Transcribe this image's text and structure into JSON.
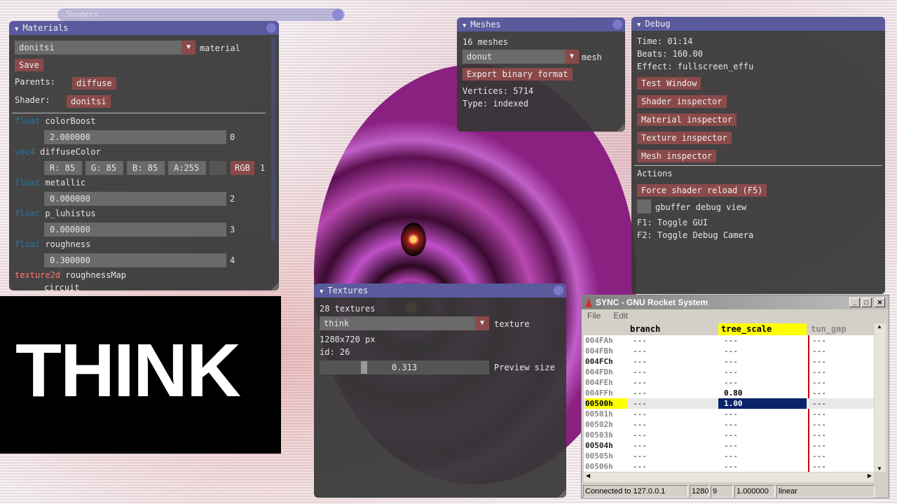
{
  "shaders_title": "Shaders",
  "materials": {
    "title": "Materials",
    "selected": "donitsi",
    "label": "material",
    "save": "Save",
    "parents_label": "Parents:",
    "parents_value": "diffuse",
    "shader_label": "Shader:",
    "shader_value": "donitsi",
    "params": [
      {
        "type": "float",
        "name": "colorBoost",
        "value": "2.000000",
        "index": "0"
      },
      {
        "type": "vec4",
        "name": "diffuseColor",
        "r": "R: 85",
        "g": "G: 85",
        "b": "B: 85",
        "a": "A:255",
        "mode": "RGB",
        "index": "1"
      },
      {
        "type": "float",
        "name": "metallic",
        "value": "0.000000",
        "index": "2"
      },
      {
        "type": "float",
        "name": "p_luhistus",
        "value": "0.000000",
        "index": "3"
      },
      {
        "type": "float",
        "name": "roughness",
        "value": "0.300000",
        "index": "4"
      },
      {
        "type": "texture2d",
        "name": "roughnessMap",
        "value": "circuit"
      }
    ]
  },
  "meshes": {
    "title": "Meshes",
    "count": "16 meshes",
    "selected": "donut",
    "label": "mesh",
    "export": "Export binary format",
    "vertices": "Vertices: 5714",
    "type": "Type: indexed"
  },
  "debug": {
    "title": "Debug",
    "time": "Time: 01:14",
    "beats": "Beats: 160.00",
    "effect": "Effect: fullscreen_effu",
    "buttons": [
      "Test Window",
      "Shader inspector",
      "Material inspector",
      "Texture inspector",
      "Mesh inspector"
    ],
    "actions": "Actions",
    "reload": "Force shader reload (F5)",
    "gbuffer": "gbuffer debug view",
    "f1": "F1: Toggle GUI",
    "f2": "F2: Toggle Debug Camera"
  },
  "textures": {
    "title": "Textures",
    "count": "28 textures",
    "selected": "think",
    "label": "texture",
    "size": "1280x720 px",
    "id": "id: 26",
    "preview_value": "0.313",
    "preview_label": "Preview size",
    "preview_fraction": 0.313
  },
  "think_text": "THINK",
  "rocket": {
    "title": "SYNC - GNU Rocket System",
    "menu": [
      "File",
      "Edit"
    ],
    "columns": [
      "branch",
      "tree_scale",
      "tun_gap"
    ],
    "rows": [
      {
        "label": "004FAh",
        "c": [
          "---",
          "---",
          "---"
        ],
        "bold": false
      },
      {
        "label": "004FBh",
        "c": [
          "---",
          "---",
          "---"
        ],
        "bold": false
      },
      {
        "label": "004FCh",
        "c": [
          "---",
          "---",
          "---"
        ],
        "bold": true
      },
      {
        "label": "004FDh",
        "c": [
          "---",
          "---",
          "---"
        ],
        "bold": false
      },
      {
        "label": "004FEh",
        "c": [
          "---",
          "---",
          "---"
        ],
        "bold": false
      },
      {
        "label": "004FFh",
        "c": [
          "---",
          "0.80",
          "---"
        ],
        "bold": false
      },
      {
        "label": "00500h",
        "c": [
          "---",
          "1.00",
          "---"
        ],
        "bold": false,
        "current": true
      },
      {
        "label": "00501h",
        "c": [
          "---",
          "---",
          "---"
        ],
        "bold": false
      },
      {
        "label": "00502h",
        "c": [
          "---",
          "---",
          "---"
        ],
        "bold": false
      },
      {
        "label": "00503h",
        "c": [
          "---",
          "---",
          "---"
        ],
        "bold": false
      },
      {
        "label": "00504h",
        "c": [
          "---",
          "---",
          "---"
        ],
        "bold": true
      },
      {
        "label": "00505h",
        "c": [
          "---",
          "---",
          "---"
        ],
        "bold": false
      },
      {
        "label": "00506h",
        "c": [
          "---",
          "---",
          "---"
        ],
        "bold": false
      }
    ],
    "status": [
      "Connected to 127.0.0.1",
      "1280",
      "9",
      "1.000000",
      "linear"
    ]
  },
  "colors": {
    "titlebar": "#5a5a9c",
    "button": "#8a4a4a",
    "selected_cell": "#0a246a",
    "current_row": "#ffff00"
  }
}
